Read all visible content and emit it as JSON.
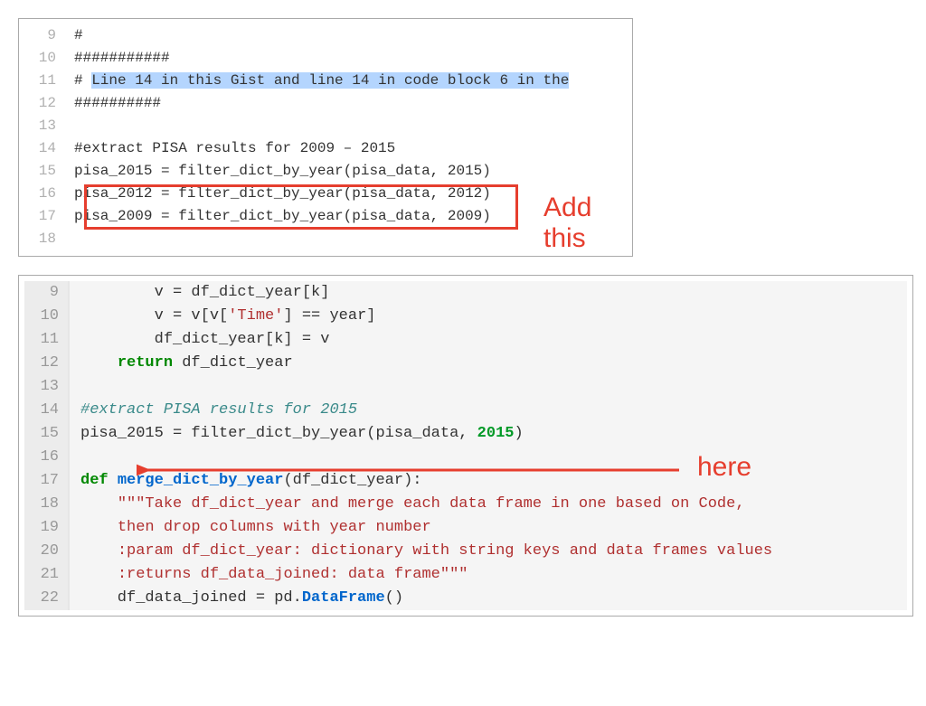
{
  "panel1": {
    "lines": [
      {
        "num": "9",
        "text": "#"
      },
      {
        "num": "10",
        "text": "###########"
      },
      {
        "num": "11",
        "prefix": "# ",
        "highlighted": "Line 14 in this Gist and line 14 in code block 6 in the"
      },
      {
        "num": "12",
        "text": "##########"
      },
      {
        "num": "13",
        "text": ""
      },
      {
        "num": "14",
        "text": "#extract PISA results for 2009 – 2015"
      },
      {
        "num": "15",
        "text": "pisa_2015 = filter_dict_by_year(pisa_data, 2015)"
      },
      {
        "num": "16",
        "text": "pisa_2012 = filter_dict_by_year(pisa_data, 2012)"
      },
      {
        "num": "17",
        "text": "pisa_2009 = filter_dict_by_year(pisa_data, 2009)"
      },
      {
        "num": "18",
        "text": ""
      }
    ],
    "annotation": "Add this"
  },
  "panel2": {
    "lines": [
      {
        "num": "9",
        "segments": [
          {
            "t": "        v = df_dict_year[k]"
          }
        ]
      },
      {
        "num": "10",
        "segments": [
          {
            "t": "        v = v[v["
          },
          {
            "t": "'Time'",
            "cls": "str-red"
          },
          {
            "t": "] == year]"
          }
        ]
      },
      {
        "num": "11",
        "segments": [
          {
            "t": "        df_dict_year[k] = v"
          }
        ]
      },
      {
        "num": "12",
        "segments": [
          {
            "t": "    "
          },
          {
            "t": "return",
            "cls": "kw-return"
          },
          {
            "t": " df_dict_year"
          }
        ]
      },
      {
        "num": "13",
        "segments": [
          {
            "t": ""
          }
        ]
      },
      {
        "num": "14",
        "segments": [
          {
            "t": "#extract PISA results for 2015",
            "cls": "comment-teal"
          }
        ]
      },
      {
        "num": "15",
        "segments": [
          {
            "t": "pisa_2015 = filter_dict_by_year(pisa_data, "
          },
          {
            "t": "2015",
            "cls": "num-green"
          },
          {
            "t": ")"
          }
        ]
      },
      {
        "num": "16",
        "segments": [
          {
            "t": ""
          }
        ]
      },
      {
        "num": "17",
        "segments": [
          {
            "t": "def",
            "cls": "kw-def"
          },
          {
            "t": " "
          },
          {
            "t": "merge_dict_by_year",
            "cls": "func-blue"
          },
          {
            "t": "(df_dict_year):"
          }
        ]
      },
      {
        "num": "18",
        "segments": [
          {
            "t": "    "
          },
          {
            "t": "\"\"\"Take df_dict_year and merge each data frame in one based on Code,",
            "cls": "docstring"
          }
        ]
      },
      {
        "num": "19",
        "segments": [
          {
            "t": "    "
          },
          {
            "t": "then drop columns with year number",
            "cls": "docstring"
          }
        ]
      },
      {
        "num": "20",
        "segments": [
          {
            "t": "    "
          },
          {
            "t": ":param df_dict_year: dictionary with string keys and data frames values",
            "cls": "docstring"
          }
        ]
      },
      {
        "num": "21",
        "segments": [
          {
            "t": "    "
          },
          {
            "t": ":returns df_data_joined: data frame\"\"\"",
            "cls": "docstring"
          }
        ]
      },
      {
        "num": "22",
        "segments": [
          {
            "t": "    df_data_joined = pd."
          },
          {
            "t": "DataFrame",
            "cls": "func-blue"
          },
          {
            "t": "()"
          }
        ]
      }
    ],
    "annotation": "here"
  }
}
